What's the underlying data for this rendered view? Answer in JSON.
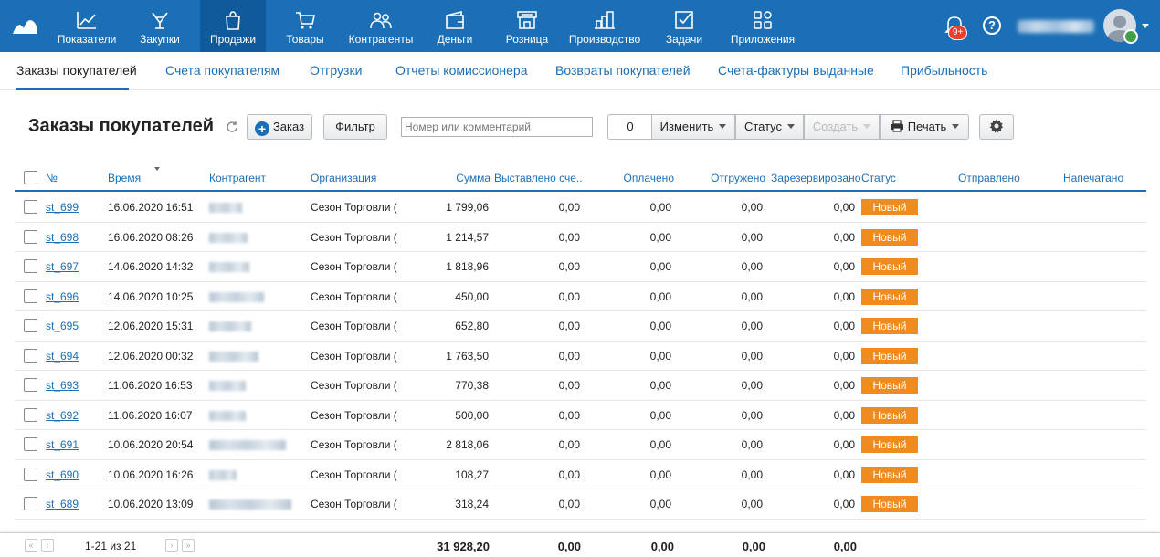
{
  "nav": {
    "items": [
      {
        "label": "Показатели",
        "icon": "chart-icon"
      },
      {
        "label": "Закупки",
        "icon": "purchase-icon"
      },
      {
        "label": "Продажи",
        "icon": "bag-icon"
      },
      {
        "label": "Товары",
        "icon": "cart-icon"
      },
      {
        "label": "Контрагенты",
        "icon": "people-icon"
      },
      {
        "label": "Деньги",
        "icon": "wallet-icon"
      },
      {
        "label": "Розница",
        "icon": "store-icon"
      },
      {
        "label": "Производство",
        "icon": "factory-icon"
      },
      {
        "label": "Задачи",
        "icon": "task-icon"
      },
      {
        "label": "Приложения",
        "icon": "apps-icon"
      }
    ],
    "active_index": 2,
    "notifications_badge": "9+",
    "help": "?"
  },
  "subtabs": [
    "Заказы покупателей",
    "Счета покупателям",
    "Отгрузки",
    "Отчеты комиссионера",
    "Возвраты покупателей",
    "Счета-фактуры выданные",
    "Прибыльность"
  ],
  "toolbar": {
    "title": "Заказы покупателей",
    "add_order": "Заказ",
    "filter": "Фильтр",
    "search_placeholder": "Номер или комментарий",
    "selected_count": "0",
    "change": "Изменить",
    "status": "Статус",
    "create": "Создать",
    "print": "Печать"
  },
  "table": {
    "columns": {
      "num": "№",
      "time": "Время",
      "counterparty": "Контрагент",
      "organization": "Организация",
      "sum": "Сумма",
      "invoiced": "Выставлено сче...",
      "paid": "Оплачено",
      "shipped": "Отгружено",
      "reserved": "Зарезервировано",
      "status": "Статус",
      "sent": "Отправлено",
      "printed": "Напечатано"
    },
    "rows": [
      {
        "num": "st_699",
        "time": "16.06.2020 16:51",
        "org": "Сезон Торговли (",
        "sum": "1 799,06",
        "invoiced": "0,00",
        "paid": "0,00",
        "shipped": "0,00",
        "reserved": "0,00",
        "status": "Новый"
      },
      {
        "num": "st_698",
        "time": "16.06.2020 08:26",
        "org": "Сезон Торговли (",
        "sum": "1 214,57",
        "invoiced": "0,00",
        "paid": "0,00",
        "shipped": "0,00",
        "reserved": "0,00",
        "status": "Новый"
      },
      {
        "num": "st_697",
        "time": "14.06.2020 14:32",
        "org": "Сезон Торговли (",
        "sum": "1 818,96",
        "invoiced": "0,00",
        "paid": "0,00",
        "shipped": "0,00",
        "reserved": "0,00",
        "status": "Новый"
      },
      {
        "num": "st_696",
        "time": "14.06.2020 10:25",
        "org": "Сезон Торговли (",
        "sum": "450,00",
        "invoiced": "0,00",
        "paid": "0,00",
        "shipped": "0,00",
        "reserved": "0,00",
        "status": "Новый"
      },
      {
        "num": "st_695",
        "time": "12.06.2020 15:31",
        "org": "Сезон Торговли (",
        "sum": "652,80",
        "invoiced": "0,00",
        "paid": "0,00",
        "shipped": "0,00",
        "reserved": "0,00",
        "status": "Новый"
      },
      {
        "num": "st_694",
        "time": "12.06.2020 00:32",
        "org": "Сезон Торговли (",
        "sum": "1 763,50",
        "invoiced": "0,00",
        "paid": "0,00",
        "shipped": "0,00",
        "reserved": "0,00",
        "status": "Новый"
      },
      {
        "num": "st_693",
        "time": "11.06.2020 16:53",
        "org": "Сезон Торговли (",
        "sum": "770,38",
        "invoiced": "0,00",
        "paid": "0,00",
        "shipped": "0,00",
        "reserved": "0,00",
        "status": "Новый"
      },
      {
        "num": "st_692",
        "time": "11.06.2020 16:07",
        "org": "Сезон Торговли (",
        "sum": "500,00",
        "invoiced": "0,00",
        "paid": "0,00",
        "shipped": "0,00",
        "reserved": "0,00",
        "status": "Новый"
      },
      {
        "num": "st_691",
        "time": "10.06.2020 20:54",
        "org": "Сезон Торговли (",
        "sum": "2 818,06",
        "invoiced": "0,00",
        "paid": "0,00",
        "shipped": "0,00",
        "reserved": "0,00",
        "status": "Новый"
      },
      {
        "num": "st_690",
        "time": "10.06.2020 16:26",
        "org": "Сезон Торговли (",
        "sum": "108,27",
        "invoiced": "0,00",
        "paid": "0,00",
        "shipped": "0,00",
        "reserved": "0,00",
        "status": "Новый"
      },
      {
        "num": "st_689",
        "time": "10.06.2020 13:09",
        "org": "Сезон Торговли (",
        "sum": "318,24",
        "invoiced": "0,00",
        "paid": "0,00",
        "shipped": "0,00",
        "reserved": "0,00",
        "status": "Новый"
      }
    ]
  },
  "footer": {
    "range": "1-21 из 21",
    "sum": "31 928,20",
    "invoiced": "0,00",
    "paid": "0,00",
    "shipped": "0,00",
    "reserved": "0,00"
  },
  "colors": {
    "primary": "#1b6fb6",
    "status_new": "#ef8b1f"
  }
}
